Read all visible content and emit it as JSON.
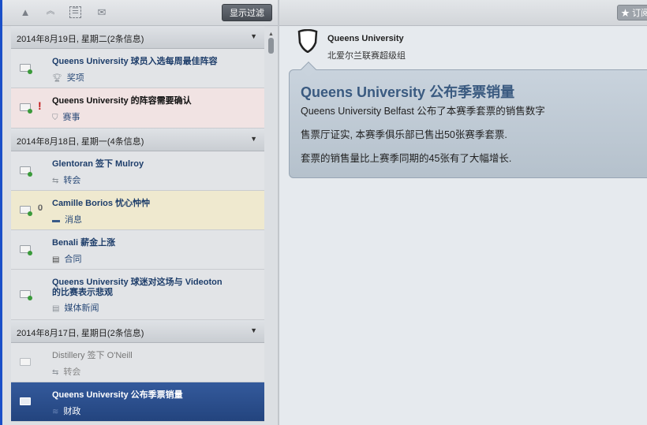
{
  "toolbar": {
    "filter_label": "显示过滤",
    "subscribe_label": "订阅"
  },
  "groups": [
    {
      "label": "2014年8月19日, 星期二(2条信息)"
    },
    {
      "label": "2014年8月18日, 星期一(4条信息)"
    },
    {
      "label": "2014年8月17日, 星期日(2条信息)"
    }
  ],
  "items": [
    {
      "title": "Queens University 球员入选每周最佳阵容",
      "category": "奖项",
      "icon": "trophy-icon"
    },
    {
      "title": "Queens University 的阵容需要确认",
      "category": "赛事",
      "icon": "shield-icon",
      "flag": "!"
    },
    {
      "title": "Glentoran 签下 Mulroy",
      "category": "转会",
      "icon": "transfer-icon"
    },
    {
      "title": "Camille Borios 忧心忡忡",
      "category": "消息",
      "icon": "message-icon"
    },
    {
      "title": "Benali 薪金上涨",
      "category": "合同",
      "icon": "contract-icon"
    },
    {
      "title": "Queens University 球迷对这场与 Videoton 的比赛表示悲观",
      "category": "媒体新闻",
      "icon": "newspaper-icon"
    },
    {
      "title": "Distillery 签下 O'Neill",
      "category": "转会",
      "icon": "transfer-icon"
    },
    {
      "title": "Queens University 公布季票销量",
      "category": "财政",
      "icon": "finance-icon"
    }
  ],
  "detail": {
    "club": "Queens University",
    "league": "北爱尔兰联赛超级组",
    "headline": "Queens University 公布季票销量",
    "paragraphs": [
      "Queens University Belfast 公布了本赛季套票的销售数字",
      "售票厅证实, 本赛季俱乐部已售出50张赛季套票.",
      "套票的销售量比上赛季同期的45张有了大幅增长."
    ]
  }
}
